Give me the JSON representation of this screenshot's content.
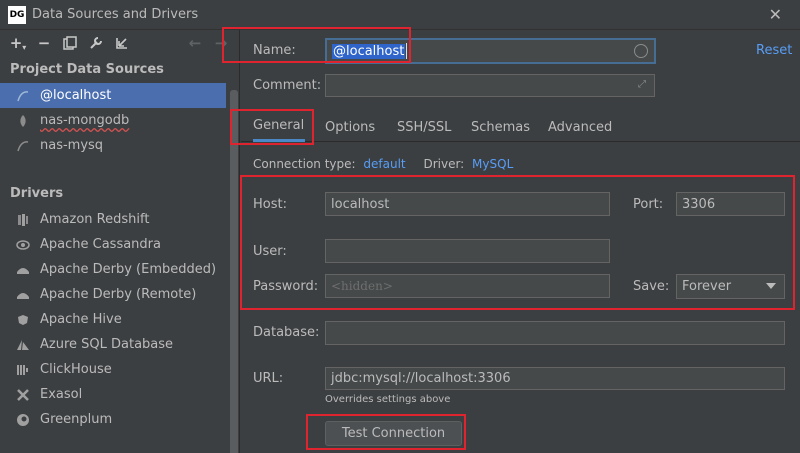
{
  "window": {
    "app_icon": "DG",
    "title": "Data Sources and Drivers",
    "close_label": "✕"
  },
  "toolbar": {
    "icons": [
      "add-icon",
      "remove-icon",
      "duplicate-icon",
      "wrench-icon",
      "import-icon",
      "back-arrow-icon",
      "forward-arrow-icon"
    ]
  },
  "sidebar": {
    "project_header": "Project Data Sources",
    "project_sources": [
      {
        "label": "@localhost",
        "icon": "mysql-icon",
        "selected": true
      },
      {
        "label": "nas-mongodb",
        "icon": "mongodb-icon",
        "selected": false
      },
      {
        "label": "nas-mysq",
        "icon": "mysql-icon",
        "selected": false
      }
    ],
    "drivers_header": "Drivers",
    "drivers": [
      {
        "label": "Amazon Redshift",
        "icon": "redshift-icon"
      },
      {
        "label": "Apache Cassandra",
        "icon": "cassandra-icon"
      },
      {
        "label": "Apache Derby (Embedded)",
        "icon": "derby-icon"
      },
      {
        "label": "Apache Derby (Remote)",
        "icon": "derby-icon"
      },
      {
        "label": "Apache Hive",
        "icon": "hive-icon"
      },
      {
        "label": "Azure SQL Database",
        "icon": "azure-icon"
      },
      {
        "label": "ClickHouse",
        "icon": "clickhouse-icon"
      },
      {
        "label": "Exasol",
        "icon": "exasol-icon"
      },
      {
        "label": "Greenplum",
        "icon": "greenplum-icon"
      }
    ]
  },
  "form": {
    "name_label": "Name:",
    "name_value": "@localhost",
    "reset_label": "Reset",
    "comment_label": "Comment:",
    "comment_value": "",
    "tabs": [
      "General",
      "Options",
      "SSH/SSL",
      "Schemas",
      "Advanced"
    ],
    "active_tab": "General",
    "connection_type_label": "Connection type:",
    "connection_type_value": "default",
    "driver_label": "Driver:",
    "driver_value": "MySQL",
    "host_label": "Host:",
    "host_value": "localhost",
    "port_label": "Port:",
    "port_value": "3306",
    "user_label": "User:",
    "user_value": "",
    "password_label": "Password:",
    "password_placeholder": "<hidden>",
    "save_label": "Save:",
    "save_value": "Forever",
    "database_label": "Database:",
    "database_value": "",
    "url_label": "URL:",
    "url_value": "jdbc:mysql://localhost:3306",
    "url_hint": "Overrides settings above",
    "test_button": "Test Connection"
  },
  "colors": {
    "background": "#3c3f41",
    "selection": "#4b6eaf",
    "link": "#589df6",
    "annotation": "#e0242f"
  }
}
